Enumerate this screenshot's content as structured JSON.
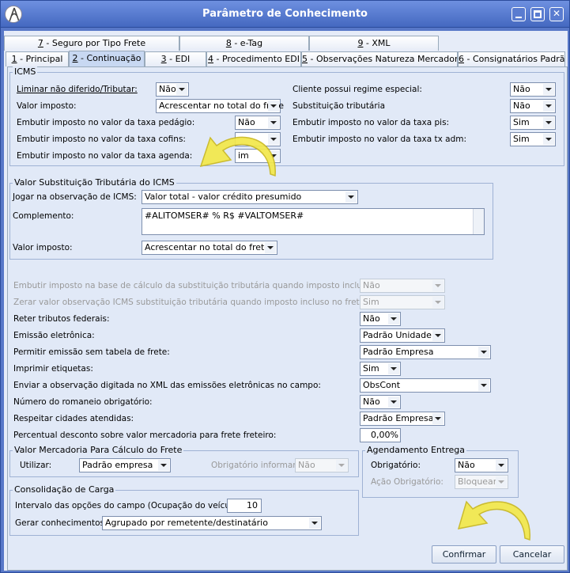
{
  "window": {
    "title": "Parâmetro de Conhecimento"
  },
  "tabs": {
    "row1": [
      {
        "num": "7",
        "label": " - Seguro por Tipo Frete"
      },
      {
        "num": "8",
        "label": " - e-Tag"
      },
      {
        "num": "9",
        "label": " - XML"
      }
    ],
    "row2": [
      {
        "num": "1",
        "label": " - Principal"
      },
      {
        "num": "2",
        "label": " - Continuação"
      },
      {
        "num": "3",
        "label": " - EDI"
      },
      {
        "num": "4",
        "label": " - Procedimento EDI"
      },
      {
        "num": "5",
        "label": " - Observações Natureza Mercadoria"
      },
      {
        "num": "6",
        "label": " - Consignatários Padrão"
      }
    ]
  },
  "icms": {
    "title": "ICMS",
    "liminar_label": "Liminar não diferido/Tributar:",
    "liminar_value": "Não",
    "valor_imposto_label": "Valor imposto:",
    "valor_imposto_value": "Acrescentar no total do frete",
    "embutir_pedagio_label": "Embutir imposto no valor da taxa pedágio:",
    "embutir_pedagio_value": "Não",
    "embutir_cofins_label": "Embutir imposto no valor da taxa cofins:",
    "embutir_cofins_value": "",
    "embutir_agenda_label": "Embutir imposto no valor da taxa agenda:",
    "embutir_agenda_value": "im",
    "cliente_regime_label": "Cliente possui regime especial:",
    "cliente_regime_value": "Não",
    "substituicao_label": "Substituição tributária",
    "substituicao_value": "Não",
    "embutir_pis_label": "Embutir imposto no valor da taxa pis:",
    "embutir_pis_value": "Sim",
    "embutir_txadm_label": "Embutir imposto no valor da taxa tx adm:",
    "embutir_txadm_value": "Sim"
  },
  "vst": {
    "title": "Valor Substituição Tributária do ICMS",
    "jogar_label": "Jogar na observação de ICMS:",
    "jogar_value": "Valor total - valor crédito presumido",
    "complemento_label": "Complemento:",
    "complemento_value": "#ALITOMSER# % R$ #VALTOMSER#",
    "valor_imposto_label": "Valor imposto:",
    "valor_imposto_value": "Acrescentar no total do frete"
  },
  "misc": {
    "embutir_base_label": "Embutir imposto na base de cálculo da substituição tributária quando imposto incluso no frete:",
    "embutir_base_value": "Não",
    "zerar_label": "Zerar valor observação ICMS substituição tributária quando imposto incluso no frete:",
    "zerar_value": "Sim",
    "reter_label": "Reter tributos federais:",
    "reter_value": "Não",
    "emissao_label": "Emissão eletrônica:",
    "emissao_value": "Padrão Unidade",
    "permitir_label": "Permitir emissão sem tabela de frete:",
    "permitir_value": "Padrão Empresa",
    "imprimir_label": "Imprimir etiquetas:",
    "imprimir_value": "Sim",
    "enviar_label": "Enviar a observação digitada no XML das emissões eletrônicas no campo:",
    "enviar_value": "ObsCont",
    "romaneio_label": "Número do romaneio obrigatório:",
    "romaneio_value": "Não",
    "respeitar_label": "Respeitar cidades atendidas:",
    "respeitar_value": "Padrão Empresa",
    "percentual_label": "Percentual desconto sobre valor mercadoria para frete freteiro:",
    "percentual_value": "0,00%"
  },
  "vm": {
    "title": "Valor Mercadoria Para Cálculo do Frete",
    "utilizar_label": "Utilizar:",
    "utilizar_value": "Padrão empresa",
    "obrigatorio_label": "Obrigatório informar:",
    "obrigatorio_value": "Não"
  },
  "agenda": {
    "title": "Agendamento Entrega",
    "obrigatorio_label": "Obrigatório:",
    "obrigatorio_value": "Não",
    "acao_label": "Ação Obrigatório:",
    "acao_value": "Bloquear"
  },
  "consol": {
    "title": "Consolidação de Carga",
    "intervalo_label": "Intervalo das opções do campo (Ocupação do veículo):",
    "intervalo_value": "10",
    "gerar_label": "Gerar conhecimentos:",
    "gerar_value": "Agrupado por remetente/destinatário"
  },
  "buttons": {
    "confirmar": "Confirmar",
    "cancelar": "Cancelar"
  },
  "icons": {
    "logo": "app-logo-icon",
    "minimize": "minimize-icon",
    "maximize": "maximize-icon",
    "close": "close-icon",
    "hint": "curved-arrow-icon"
  },
  "colors": {
    "titlebar": "#5070c8",
    "panel": "#e1e9f7",
    "hint_arrow": "#f3e84a"
  }
}
